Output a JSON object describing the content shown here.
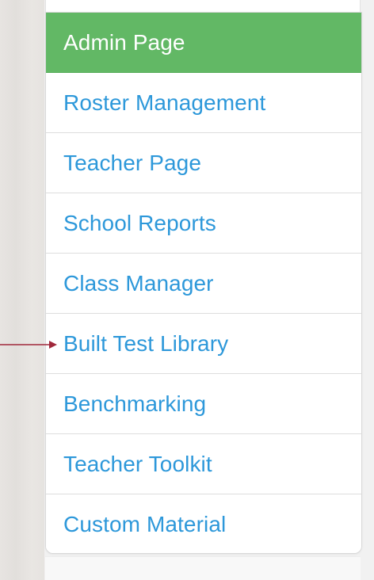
{
  "menu": {
    "items": [
      {
        "label": "Admin Page",
        "active": true
      },
      {
        "label": "Roster Management",
        "active": false
      },
      {
        "label": "Teacher Page",
        "active": false
      },
      {
        "label": "School Reports",
        "active": false
      },
      {
        "label": "Class Manager",
        "active": false
      },
      {
        "label": "Built Test Library",
        "active": false
      },
      {
        "label": "Benchmarking",
        "active": false
      },
      {
        "label": "Teacher Toolkit",
        "active": false
      },
      {
        "label": "Custom Material",
        "active": false
      }
    ]
  },
  "colors": {
    "active_background": "#62b865",
    "link_text": "#2d98da",
    "arrow": "#a0283b"
  },
  "annotation": {
    "arrow_target": "Built Test Library"
  }
}
